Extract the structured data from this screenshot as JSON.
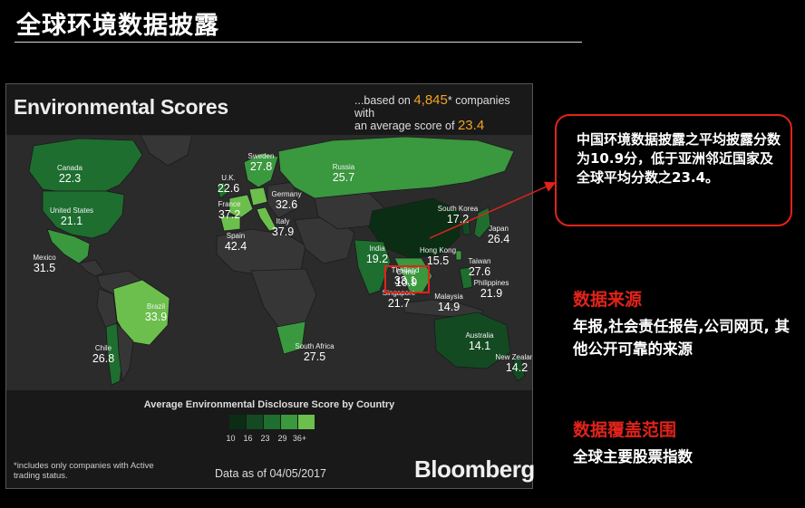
{
  "slide": {
    "title": "全球环境数据披露"
  },
  "map": {
    "title": "Environmental Scores",
    "subtitle": {
      "pre": "...based on ",
      "count": "4,845",
      "mid": "* companies with",
      "line2": "an average score of ",
      "avg": "23.4"
    },
    "legend": {
      "title": "Average Environmental Disclosure Score by Country",
      "ticks": [
        "10",
        "16",
        "23",
        "29",
        "36+"
      ],
      "colors": [
        "#0b2d14",
        "#134a22",
        "#1e6e2f",
        "#3a983e",
        "#6cbf4d"
      ]
    },
    "footnote": "*includes only companies with Active trading status.",
    "data_as_of": "Data as of 04/05/2017",
    "brand": "Bloomberg",
    "highlight_color": "#e2231a"
  },
  "countries": [
    {
      "name": "Canada",
      "score": "22.3"
    },
    {
      "name": "United States",
      "score": "21.1"
    },
    {
      "name": "Mexico",
      "score": "31.5"
    },
    {
      "name": "Brazil",
      "score": "33.9"
    },
    {
      "name": "Chile",
      "score": "26.8"
    },
    {
      "name": "U.K.",
      "score": "22.6"
    },
    {
      "name": "Sweden",
      "score": "27.8"
    },
    {
      "name": "France",
      "score": "37.2"
    },
    {
      "name": "Germany",
      "score": "32.6"
    },
    {
      "name": "Spain",
      "score": "42.4"
    },
    {
      "name": "Italy",
      "score": "37.9"
    },
    {
      "name": "Russia",
      "score": "25.7"
    },
    {
      "name": "South Africa",
      "score": "27.5"
    },
    {
      "name": "India",
      "score": "19.2"
    },
    {
      "name": "China",
      "score": "10.9"
    },
    {
      "name": "South Korea",
      "score": "17.2"
    },
    {
      "name": "Japan",
      "score": "26.4"
    },
    {
      "name": "Hong Kong",
      "score": "15.5"
    },
    {
      "name": "Taiwan",
      "score": "27.6"
    },
    {
      "name": "Thailand",
      "score": "33.1"
    },
    {
      "name": "Philippines",
      "score": "21.9"
    },
    {
      "name": "Singapore",
      "score": "21.7"
    },
    {
      "name": "Malaysia",
      "score": "14.9"
    },
    {
      "name": "Australia",
      "score": "14.1"
    },
    {
      "name": "New Zealand",
      "score": "14.2"
    }
  ],
  "callout": {
    "text": "中国环境数据披露之平均披露分数为10.9分，低于亚洲邻近国家及全球平均分数之23.4。"
  },
  "source": {
    "heading": "数据来源",
    "text": "年报,社会责任报告,公司网页, 其他公开可靠的来源"
  },
  "coverage": {
    "heading": "数据覆盖范围",
    "text": "全球主要股票指数"
  }
}
